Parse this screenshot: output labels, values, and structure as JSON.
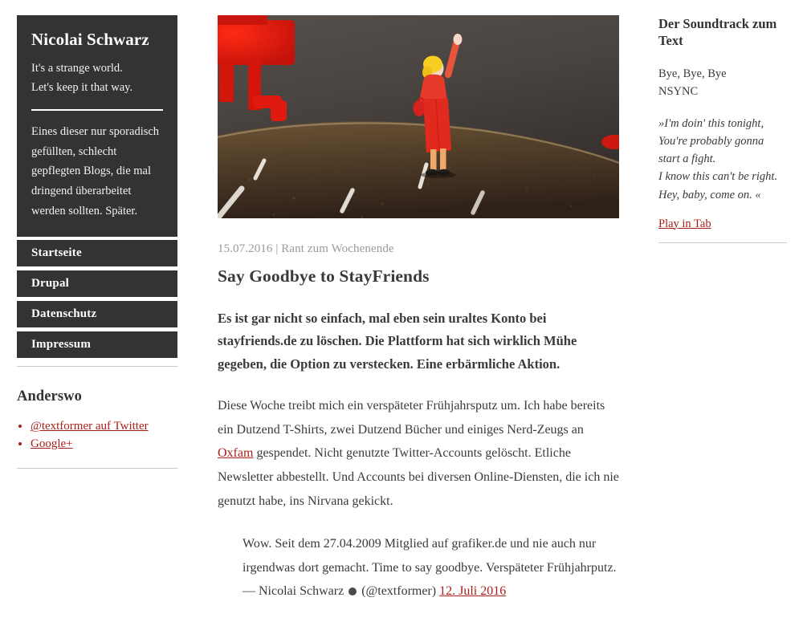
{
  "site": {
    "brand_name": "Nicolai Schwarz",
    "tagline_line1": "It's a strange world.",
    "tagline_line2": "Let's keep it that way.",
    "description": "Eines dieser nur sporadisch gefüllten, schlecht gepflegten Blogs, die mal dringend überarbeitet werden sollten. Später."
  },
  "nav": {
    "items": [
      {
        "label": "Startseite"
      },
      {
        "label": "Drupal"
      },
      {
        "label": "Datenschutz"
      },
      {
        "label": "Impressum"
      }
    ]
  },
  "elsewhere": {
    "heading": "Anderswo",
    "links": [
      {
        "label": "@textformer auf Twitter"
      },
      {
        "label": "Google+"
      }
    ]
  },
  "post": {
    "image_alt": "Rote Modellfigur einer winkenden Frau auf einer Modellbahnstrecke",
    "date": "15.07.2016",
    "separator": "|",
    "category": "Rant zum Wochenende",
    "meta": "15.07.2016 | Rant zum Wochenende",
    "title": "Say Goodbye to StayFriends",
    "lead": "Es ist gar nicht so einfach, mal eben sein uraltes Konto bei stayfriends.de zu löschen. Die Plattform hat sich wirklich Mühe gegeben, die Option zu verstecken. Eine erbärmliche Aktion.",
    "body_part1": "Diese Woche treibt mich ein verspäteter Frühjahrsputz um. Ich habe bereits ein Dutzend T-Shirts, zwei Dutzend Bücher und einiges Nerd-Zeugs an ",
    "body_link": "Oxfam",
    "body_part2": " gespendet. Nicht genutzte Twitter-Accounts gelöscht. Etliche Newsletter abbestellt. Und Accounts bei diversen Online-Diensten, die ich nie genutzt habe, ins Nirvana gekickt.",
    "quote_text": "Wow. Seit dem 27.04.2009 Mitglied auf grafiker.de und nie auch nur irgendwas dort gemacht. Time to say goodbye. Verspäteter Frühjahrputz.",
    "quote_dash": "—",
    "quote_author": "Nicolai Schwarz",
    "quote_emoji": "emoji-glyph",
    "quote_handle": "(@textformer)",
    "quote_date": "12. Juli 2016"
  },
  "soundtrack": {
    "heading": "Der Soundtrack zum Text",
    "song_title": "Bye, Bye, Bye",
    "artist": "NSYNC",
    "lyrics_line1": "»I'm doin' this tonight,",
    "lyrics_line2": "You're probably gonna",
    "lyrics_line3": "start a fight.",
    "lyrics_line4": "I know this can't be right.",
    "lyrics_line5": "Hey, baby, come on. «",
    "play_label": "Play in Tab"
  },
  "colors": {
    "panel_dark": "#333333",
    "link_red": "#a8201a",
    "text": "#3a3a3a",
    "meta_gray": "#9b9b9b",
    "rule_gray": "#c9c9c9"
  }
}
